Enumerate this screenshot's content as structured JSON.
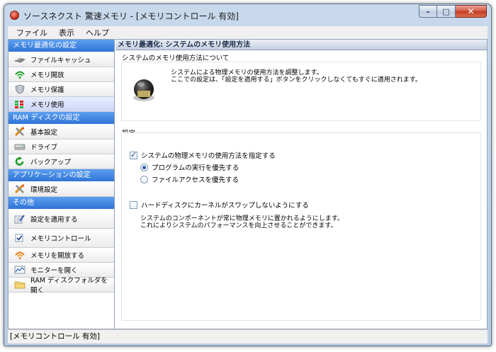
{
  "window": {
    "title": "ソースネクスト 驚速メモリ - [メモリコントロール 有効]"
  },
  "menubar": [
    "ファイル",
    "表示",
    "ヘルプ"
  ],
  "sidebar": {
    "groups": [
      {
        "header": "メモリ最適化の設定",
        "items": [
          {
            "label": "ファイルキャッシュ",
            "icon": "cable-icon"
          },
          {
            "label": "メモリ開放",
            "icon": "wifi-release-icon"
          },
          {
            "label": "メモリ保護",
            "icon": "shield-icon"
          },
          {
            "label": "メモリ使用",
            "icon": "memory-bars-icon",
            "active": true
          }
        ]
      },
      {
        "header": "RAM ディスクの設定",
        "items": [
          {
            "label": "基本設定",
            "icon": "tools-icon"
          },
          {
            "label": "ドライブ",
            "icon": "drive-icon"
          },
          {
            "label": "バックアップ",
            "icon": "backup-icon"
          }
        ]
      },
      {
        "header": "アプリケーションの設定",
        "items": [
          {
            "label": "環境設定",
            "icon": "tools-icon"
          }
        ]
      },
      {
        "header": "その他",
        "items": [
          {
            "label": "設定を適用する",
            "icon": "apply-icon"
          },
          {
            "label": "メモリコントロール",
            "icon": "checkbox-icon"
          },
          {
            "label": "メモリを開放する",
            "icon": "release-icon"
          },
          {
            "label": "モニターを開く",
            "icon": "monitor-icon"
          },
          {
            "label": "RAM ディスクフォルダを開く",
            "icon": "folder-icon"
          }
        ]
      }
    ]
  },
  "main": {
    "header": "メモリ最適化: システムのメモリ使用方法",
    "about": {
      "title": "システムのメモリ使用方法について",
      "line1": "システムによる物理メモリの使用方法を調整します。",
      "line2": "ここでの設定は、「設定を適用する」ボタンをクリックしなくてもすぐに適用されます。"
    },
    "settings": {
      "title": "設定",
      "specify_label": "システムの物理メモリの使用方法を指定する",
      "specify_checked": true,
      "radio_program": "プログラムの実行を優先する",
      "radio_program_selected": true,
      "radio_file": "ファイルアクセスを優先する",
      "radio_file_selected": false,
      "noswap_label": "ハードディスクにカーネルがスワップしないようにする",
      "noswap_checked": false,
      "noswap_desc1": "システムのコンポーネントが常に物理メモリに置かれるようにします。",
      "noswap_desc2": "これによりシステムのパフォーマンスを向上させることができます。"
    }
  },
  "statusbar": "[メモリコントロール 有効]",
  "colors": {
    "sidebar_header": "#2f74d6",
    "accent": "#2c5fb0"
  }
}
